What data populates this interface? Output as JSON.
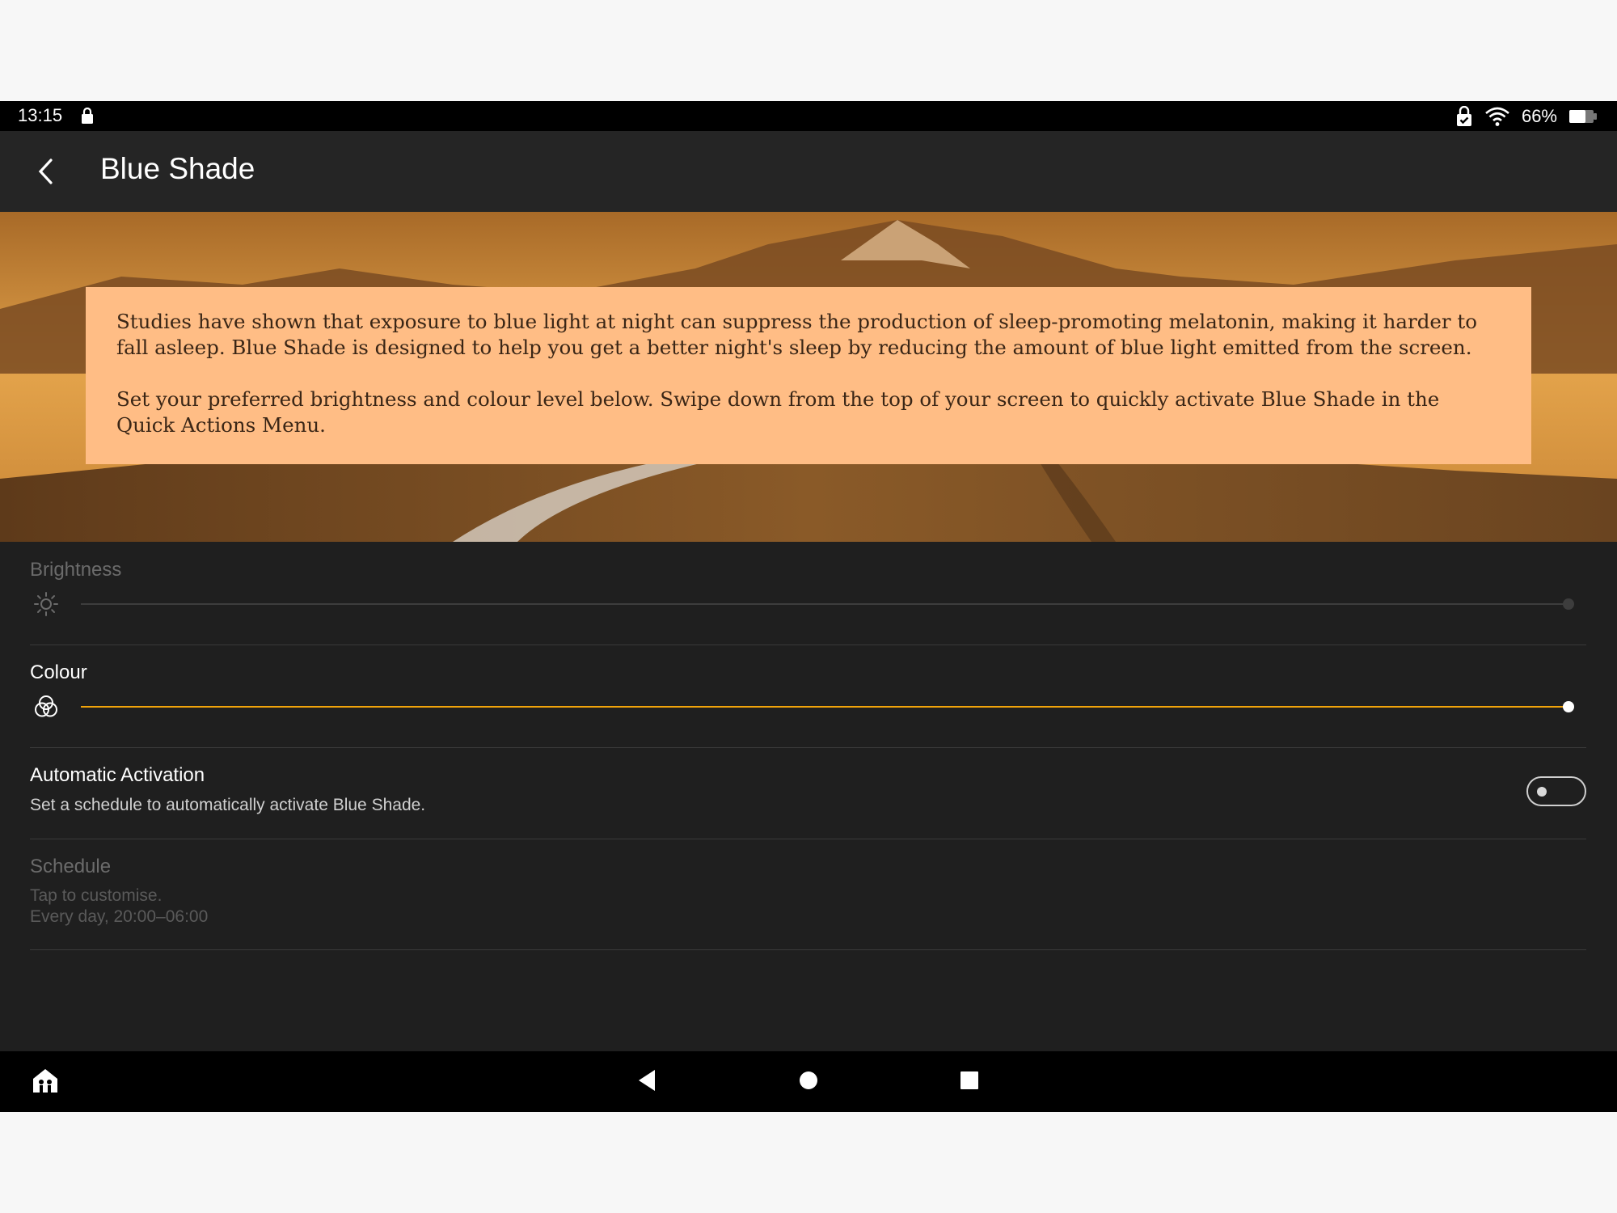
{
  "status_bar": {
    "time": "13:15",
    "battery": "66%",
    "icons": [
      "lock-icon",
      "lock-badge-icon",
      "wifi-icon",
      "battery-icon"
    ]
  },
  "app_bar": {
    "title": "Blue Shade",
    "back_icon": "back-arrow-icon"
  },
  "info": {
    "paragraph1": "Studies have shown that exposure to blue light at night can suppress the production of sleep-promoting melatonin, making it harder to fall asleep. Blue Shade is designed to help you get a better night's sleep by reducing the amount of blue light emitted from the screen.",
    "paragraph2": "Set your preferred brightness and colour level below. Swipe down from the top of your screen to quickly activate Blue Shade in the Quick Actions Menu."
  },
  "brightness": {
    "label": "Brightness",
    "icon": "sun-icon",
    "value": 1.0,
    "enabled": false
  },
  "colour": {
    "label": "Colour",
    "icon": "colour-circles-icon",
    "value": 1.0,
    "accent": "#f0a30a"
  },
  "automatic_activation": {
    "label": "Automatic Activation",
    "description": "Set a schedule to automatically activate Blue Shade.",
    "toggle_on": false
  },
  "schedule": {
    "label": "Schedule",
    "hint": "Tap to customise.",
    "value": "Every day, 20:00–06:00",
    "enabled": false
  },
  "nav_bar": {
    "icons": [
      "kids-home-icon",
      "nav-back-icon",
      "nav-home-icon",
      "nav-recents-icon"
    ]
  }
}
